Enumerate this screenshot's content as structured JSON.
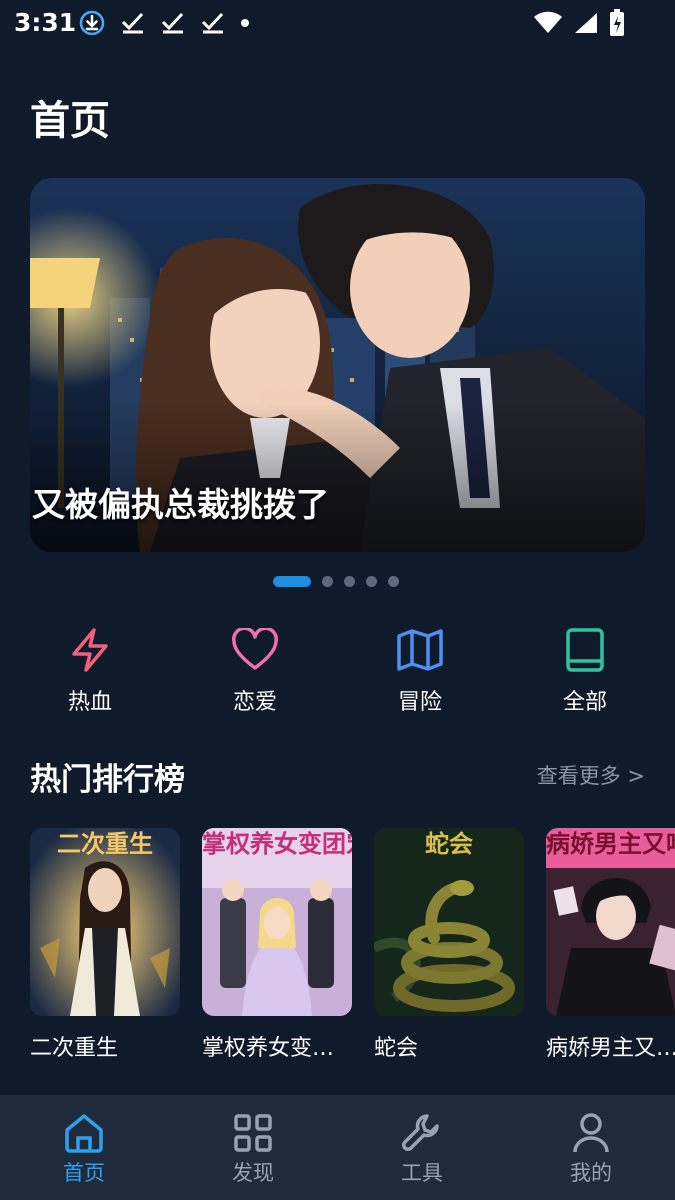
{
  "status_bar": {
    "time": "3:31",
    "left_icons": [
      "download-icon",
      "check-icon",
      "check-icon",
      "check-icon",
      "dot-icon"
    ],
    "right_icons": [
      "wifi-icon",
      "signal-icon",
      "battery-icon"
    ]
  },
  "page": {
    "title": "首页"
  },
  "banner": {
    "title": "又被偏执总裁挑拨了",
    "slides": 5,
    "active_slide": 1
  },
  "categories": [
    {
      "label": "热血",
      "icon": "lightning-icon",
      "color": "#f0607a"
    },
    {
      "label": "恋爱",
      "icon": "heart-icon",
      "color": "#ef6fb0"
    },
    {
      "label": "冒险",
      "icon": "map-icon",
      "color": "#4f8ff0"
    },
    {
      "label": "全部",
      "icon": "book-icon",
      "color": "#2ec4a0"
    }
  ],
  "ranking": {
    "title": "热门排行榜",
    "see_more": "查看更多 >",
    "items": [
      {
        "name": "二次重生",
        "cover_text": "二次重生"
      },
      {
        "name": "掌权养女变…",
        "cover_text": "掌权养女变团宠"
      },
      {
        "name": "蛇会",
        "cover_text": "蛇会"
      },
      {
        "name": "病娇男主又…",
        "cover_text": "病娇男主又吃醋"
      }
    ]
  },
  "bottom_nav": [
    {
      "label": "首页",
      "icon": "home-icon",
      "active": true
    },
    {
      "label": "发现",
      "icon": "grid-icon",
      "active": false
    },
    {
      "label": "工具",
      "icon": "wrench-icon",
      "active": false
    },
    {
      "label": "我的",
      "icon": "user-icon",
      "active": false
    }
  ],
  "colors": {
    "background": "#0f1a2b",
    "accent": "#2ea0f0",
    "nav_bg": "#1f2a3a"
  }
}
